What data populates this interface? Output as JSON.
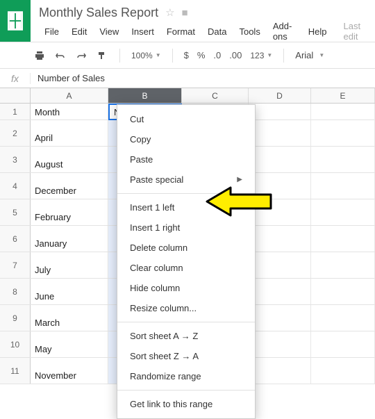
{
  "doc": {
    "title": "Monthly Sales Report"
  },
  "menu": [
    "File",
    "Edit",
    "View",
    "Insert",
    "Format",
    "Data",
    "Tools",
    "Add-ons",
    "Help"
  ],
  "last_edit": "Last edit",
  "toolbar": {
    "zoom": "100%",
    "fmt": [
      "$",
      "%",
      ".0",
      ".00",
      "123"
    ],
    "font": "Arial"
  },
  "formula": {
    "value": "Number of Sales"
  },
  "columns": [
    "A",
    "B",
    "C",
    "D",
    "E"
  ],
  "selected_column": "B",
  "active_cell_value": "Num",
  "rows": [
    {
      "n": "1",
      "A": "Month",
      "B": "Num"
    },
    {
      "n": "2",
      "A": "April"
    },
    {
      "n": "3",
      "A": "August"
    },
    {
      "n": "4",
      "A": "December"
    },
    {
      "n": "5",
      "A": "February"
    },
    {
      "n": "6",
      "A": "January"
    },
    {
      "n": "7",
      "A": "July"
    },
    {
      "n": "8",
      "A": "June"
    },
    {
      "n": "9",
      "A": "March"
    },
    {
      "n": "10",
      "A": "May"
    },
    {
      "n": "11",
      "A": "November"
    }
  ],
  "context_menu": {
    "groups": [
      [
        "Cut",
        "Copy",
        "Paste",
        {
          "label": "Paste special",
          "submenu": true
        }
      ],
      [
        "Insert 1 left",
        "Insert 1 right",
        "Delete column",
        "Clear column",
        "Hide column",
        "Resize column..."
      ],
      [
        "Sort sheet A → Z",
        "Sort sheet Z → A",
        "Randomize range"
      ],
      [
        "Get link to this range"
      ]
    ]
  }
}
